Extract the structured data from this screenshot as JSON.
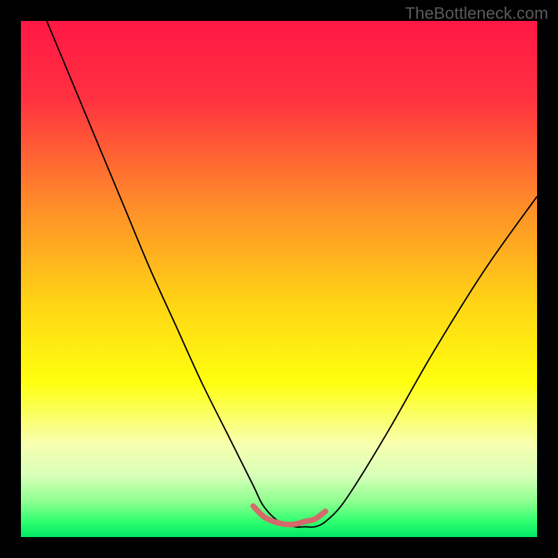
{
  "watermark": "TheBottleneck.com",
  "chart_data": {
    "type": "line",
    "title": "",
    "xlabel": "",
    "ylabel": "",
    "xlim": [
      0,
      100
    ],
    "ylim": [
      0,
      100
    ],
    "gradient_stops": [
      {
        "offset": 0,
        "color": "#ff1745"
      },
      {
        "offset": 15,
        "color": "#ff3140"
      },
      {
        "offset": 35,
        "color": "#ff8a2a"
      },
      {
        "offset": 55,
        "color": "#ffd615"
      },
      {
        "offset": 70,
        "color": "#ffff0f"
      },
      {
        "offset": 82,
        "color": "#f7ffb0"
      },
      {
        "offset": 88,
        "color": "#d8ffb8"
      },
      {
        "offset": 93,
        "color": "#90ff90"
      },
      {
        "offset": 97,
        "color": "#30ff70"
      },
      {
        "offset": 100,
        "color": "#00e865"
      }
    ],
    "series": [
      {
        "name": "bottleneck-curve",
        "color": "#000000",
        "width": 2,
        "x": [
          5,
          10,
          15,
          20,
          25,
          30,
          35,
          40,
          45,
          47,
          50,
          53,
          55,
          57,
          59,
          62,
          66,
          72,
          80,
          90,
          100
        ],
        "y": [
          100,
          88,
          76,
          64,
          52,
          41,
          30,
          20,
          10,
          6,
          3,
          2,
          2,
          2,
          3,
          6,
          12,
          22,
          36,
          52,
          66
        ]
      },
      {
        "name": "sweet-spot-highlight",
        "color": "#d46a6a",
        "width": 8,
        "x": [
          45,
          47,
          49,
          51,
          53,
          55,
          57,
          59
        ],
        "y": [
          6,
          4,
          3,
          2.5,
          2.5,
          3,
          3.5,
          5
        ]
      }
    ]
  }
}
